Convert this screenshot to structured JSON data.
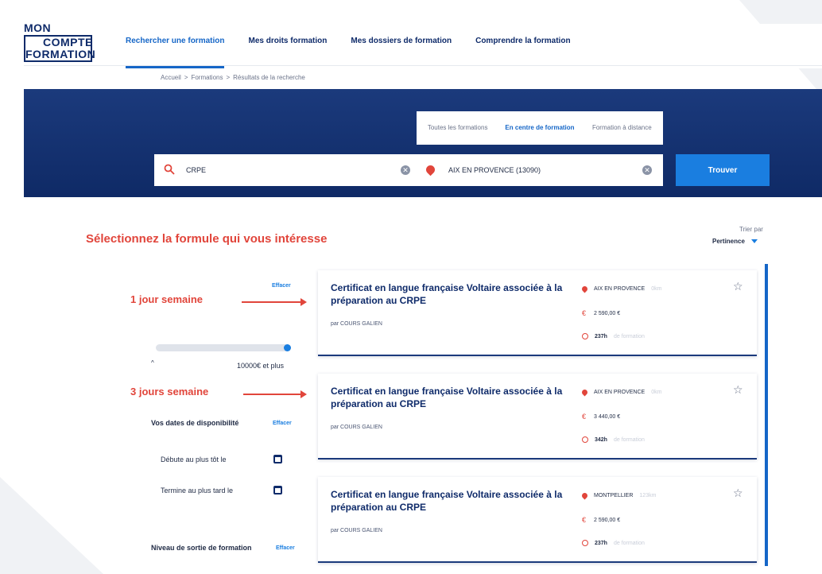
{
  "header": {
    "logo": {
      "line1": "MON",
      "line2": "COMPTE",
      "line3": "FORMATION"
    },
    "nav": [
      {
        "label": "Rechercher une formation"
      },
      {
        "label": "Mes droits formation"
      },
      {
        "label": "Mes dossiers de formation"
      },
      {
        "label": "Comprendre la formation"
      }
    ]
  },
  "breadcrumb": [
    {
      "label": "Accueil"
    },
    {
      "label": "Formations"
    },
    {
      "label": "Résultats de la recherche"
    }
  ],
  "breadcrumb_separator": ">",
  "search": {
    "modes": [
      {
        "label": "Toutes les formations"
      },
      {
        "label": "En centre de formation"
      },
      {
        "label": "Formation à distance"
      }
    ],
    "query": "CRPE",
    "location": "AIX EN PROVENCE (13090)",
    "clear_glyph": "✕",
    "submit_label": "Trouver"
  },
  "headline": "Sélectionnez la formule qui vous intéresse",
  "sort": {
    "label": "Trier par",
    "value": "Pertinence"
  },
  "annotations": [
    {
      "label": "1 jour semaine"
    },
    {
      "label": "3 jours semaine"
    }
  ],
  "filters": {
    "clear_label": "Effacer",
    "price": {
      "min_label": "^",
      "max_label": "10000€ et plus"
    },
    "availability": {
      "title": "Vos dates de disponibilité",
      "start_label": "Débute au plus tôt le",
      "end_label": "Termine au plus tard le"
    },
    "level_title": "Niveau de sortie de formation"
  },
  "results": [
    {
      "title": "Certificat en langue française Voltaire associée à la préparation au CRPE",
      "provider": "par COURS GALIEN",
      "location": "AIX EN PROVENCE",
      "distance": "0km",
      "price": "2 590,00 €",
      "duration": "237h",
      "duration_suffix": "de formation"
    },
    {
      "title": "Certificat en langue française Voltaire associée à la préparation au CRPE",
      "provider": "par COURS GALIEN",
      "location": "AIX EN PROVENCE",
      "distance": "0km",
      "price": "3 440,00 €",
      "duration": "342h",
      "duration_suffix": "de formation"
    },
    {
      "title": "Certificat en langue française Voltaire associée à la préparation au CRPE",
      "provider": "par COURS GALIEN",
      "location": "MONTPELLIER",
      "distance": "123km",
      "price": "2 590,00 €",
      "duration": "237h",
      "duration_suffix": "de formation"
    }
  ],
  "colors": {
    "brand_navy": "#0f2b6a",
    "accent_blue": "#1a7ee0",
    "annotation_red": "#e1453b"
  }
}
